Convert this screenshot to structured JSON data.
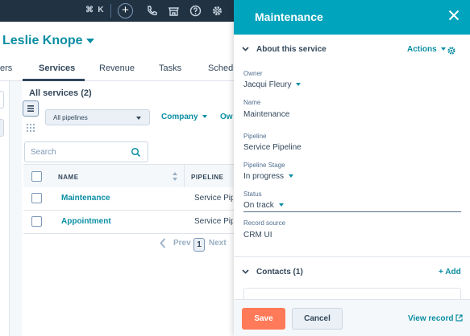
{
  "topbar": {
    "shortcut_cmd": "⌘",
    "shortcut_k": "K",
    "plus": "+",
    "icons": [
      "plus-icon",
      "phone-icon",
      "marketplace-icon",
      "help-icon",
      "settings-icon"
    ]
  },
  "record": {
    "name": "Leslie Knope",
    "tabs": [
      {
        "label": "ers",
        "active": false
      },
      {
        "label": "Services",
        "active": true
      },
      {
        "label": "Revenue",
        "active": false
      },
      {
        "label": "Tasks",
        "active": false
      },
      {
        "label": "Schedu",
        "active": false
      }
    ]
  },
  "services": {
    "title": "All services (2)",
    "pipeline_select": "All pipelines",
    "filters": [
      "Company",
      "Ow"
    ],
    "search_placeholder": "Search",
    "columns": [
      "NAME",
      "PIPELINE"
    ],
    "rows": [
      {
        "name": "Maintenance",
        "pipeline": "Service Pipeline"
      },
      {
        "name": "Appointment",
        "pipeline": "Service Pipeline"
      }
    ],
    "pager": {
      "prev": "Prev",
      "page": "1",
      "next": "Next"
    }
  },
  "panel": {
    "title": "Maintenance",
    "about": {
      "title": "About this service",
      "actions": "Actions",
      "props": [
        {
          "label": "Owner",
          "value": "Jacqui Fleury",
          "dropdown": true
        },
        {
          "label": "Name",
          "value": "Maintenance",
          "dropdown": false
        },
        {
          "label": "Pipeline",
          "value": "Service Pipeline",
          "dropdown": false
        },
        {
          "label": "Pipeline Stage",
          "value": "In progress",
          "dropdown": true
        },
        {
          "label": "Status",
          "value": "On track",
          "dropdown": true
        },
        {
          "label": "Record source",
          "value": "CRM UI",
          "dropdown": false
        }
      ]
    },
    "contacts": {
      "title": "Contacts (1)",
      "add": "+ Add"
    },
    "footer": {
      "save": "Save",
      "cancel": "Cancel",
      "view_record": "View record"
    }
  },
  "colors": {
    "accent": "#00a4bd",
    "link": "#0b8ea3",
    "nav": "#213343",
    "primary_button": "#ff7a59"
  }
}
